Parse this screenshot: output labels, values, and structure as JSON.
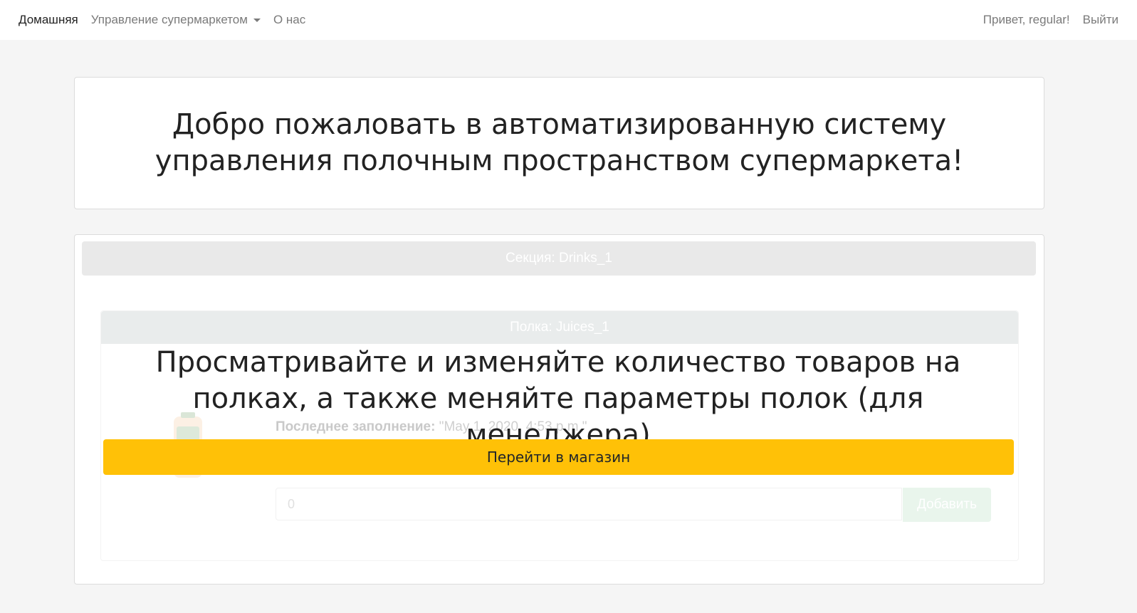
{
  "nav": {
    "home": "Домашняя",
    "manage": "Управление супермаркетом",
    "about": "О нас",
    "greeting": "Привет,  regular!",
    "logout": "Выйти"
  },
  "hero": {
    "title": "Добро пожаловать в автоматизированную систему управления полочным пространством супермаркета!"
  },
  "section": {
    "header": "Секция: Drinks_1",
    "shelf": {
      "header": "Полка: Juices_1",
      "last_fill_label": "Последнее заполнение:",
      "last_fill_value": " \"May 1, 2020, 4:53 p.m.\"",
      "quantity_value": "0",
      "add_label": "Добавить"
    }
  },
  "overlay": {
    "title": "Просматривайте и изменяйте количество товаров на полках, а также меняйте параметры полок (для менеджера)",
    "button": "Перейти в магазин"
  },
  "colors": {
    "accent": "#ffc107",
    "background": "#f5f5f5"
  }
}
